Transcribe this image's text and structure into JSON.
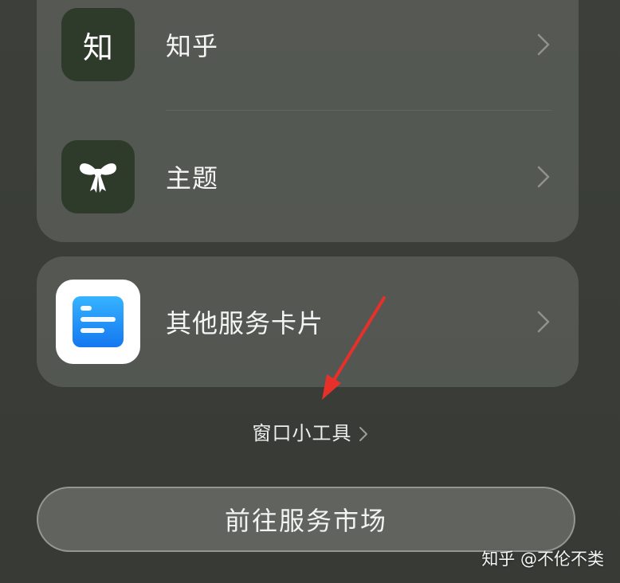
{
  "cards": {
    "top": {
      "items": [
        {
          "label": "知乎",
          "icon_char": "知",
          "icon": "zhihu-app-icon"
        },
        {
          "label": "主题",
          "icon": "bow-icon"
        }
      ]
    },
    "other_service": {
      "label": "其他服务卡片",
      "icon": "service-card-icon"
    }
  },
  "widgets_link": {
    "label": "窗口小工具"
  },
  "market_button": {
    "label": "前往服务市场"
  },
  "watermark": {
    "text": "知乎 @不伦不类"
  },
  "colors": {
    "annotation_arrow": "#e8302a",
    "service_icon_blue": "#1e8cf5"
  }
}
